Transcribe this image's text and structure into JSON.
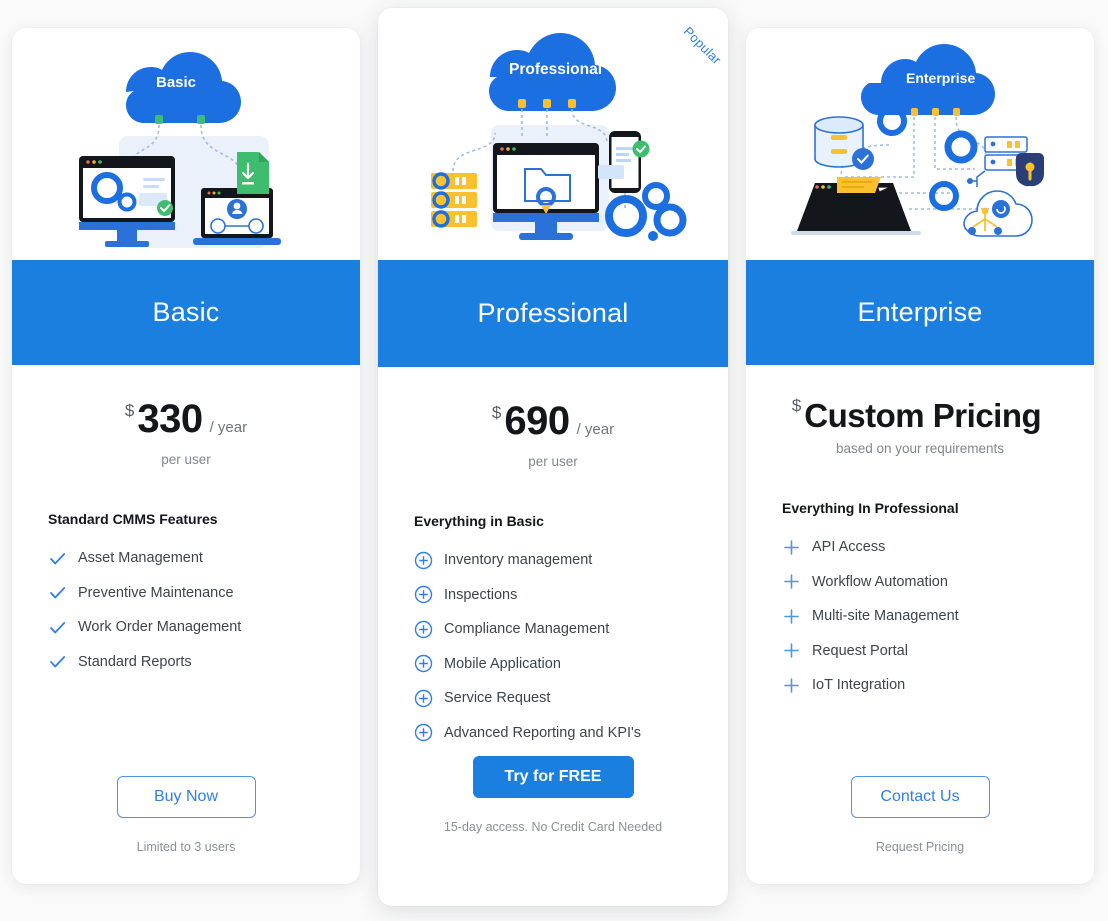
{
  "theme": {
    "brand_blue": "#1b7fe0",
    "link_blue": "#2f7fe8",
    "page_background": "#fafafa",
    "card_background": "#ffffff",
    "accent_green": "#4caf50",
    "accent_yellow": "#fbc02d"
  },
  "badge": {
    "popular_label": "Popular"
  },
  "plans": [
    {
      "id": "basic",
      "illustration_label": "Basic",
      "illustration_name": "cloud-basic-illustration",
      "name": "Basic",
      "currency": "$",
      "amount": "330",
      "period": "/  year",
      "per_user": "per user",
      "features_heading": "Standard CMMS Features",
      "feature_icon": "check-icon",
      "features": [
        "Asset Management",
        "Preventive Maintenance",
        "Work Order Management",
        "Standard Reports"
      ],
      "cta_label": "Buy Now",
      "cta_style": "outline",
      "cta_note": "Limited to 3 users"
    },
    {
      "id": "professional",
      "illustration_label": "Professional",
      "illustration_name": "cloud-professional-illustration",
      "name": "Professional",
      "currency": "$",
      "amount": "690",
      "period": "/  year",
      "per_user": "per user",
      "features_heading": "Everything in Basic",
      "feature_icon": "plus-circle-icon",
      "features": [
        "Inventory management",
        "Inspections",
        "Compliance Management",
        "Mobile Application",
        "Service Request",
        "Advanced Reporting and KPI's"
      ],
      "cta_label": "Try for FREE",
      "cta_style": "solid",
      "cta_note": "15-day access. No Credit Card Needed"
    },
    {
      "id": "enterprise",
      "illustration_label": "Enterprise",
      "illustration_name": "cloud-enterprise-illustration",
      "name": "Enterprise",
      "currency": "$",
      "amount": "Custom Pricing",
      "period": "",
      "per_user": "based on your requirements",
      "features_heading": "Everything In Professional",
      "feature_icon": "plus-icon",
      "features": [
        "API Access",
        "Workflow Automation",
        "Multi-site Management",
        "Request Portal",
        "IoT Integration"
      ],
      "cta_label": "Contact Us",
      "cta_style": "outline",
      "cta_note": "Request Pricing"
    }
  ]
}
